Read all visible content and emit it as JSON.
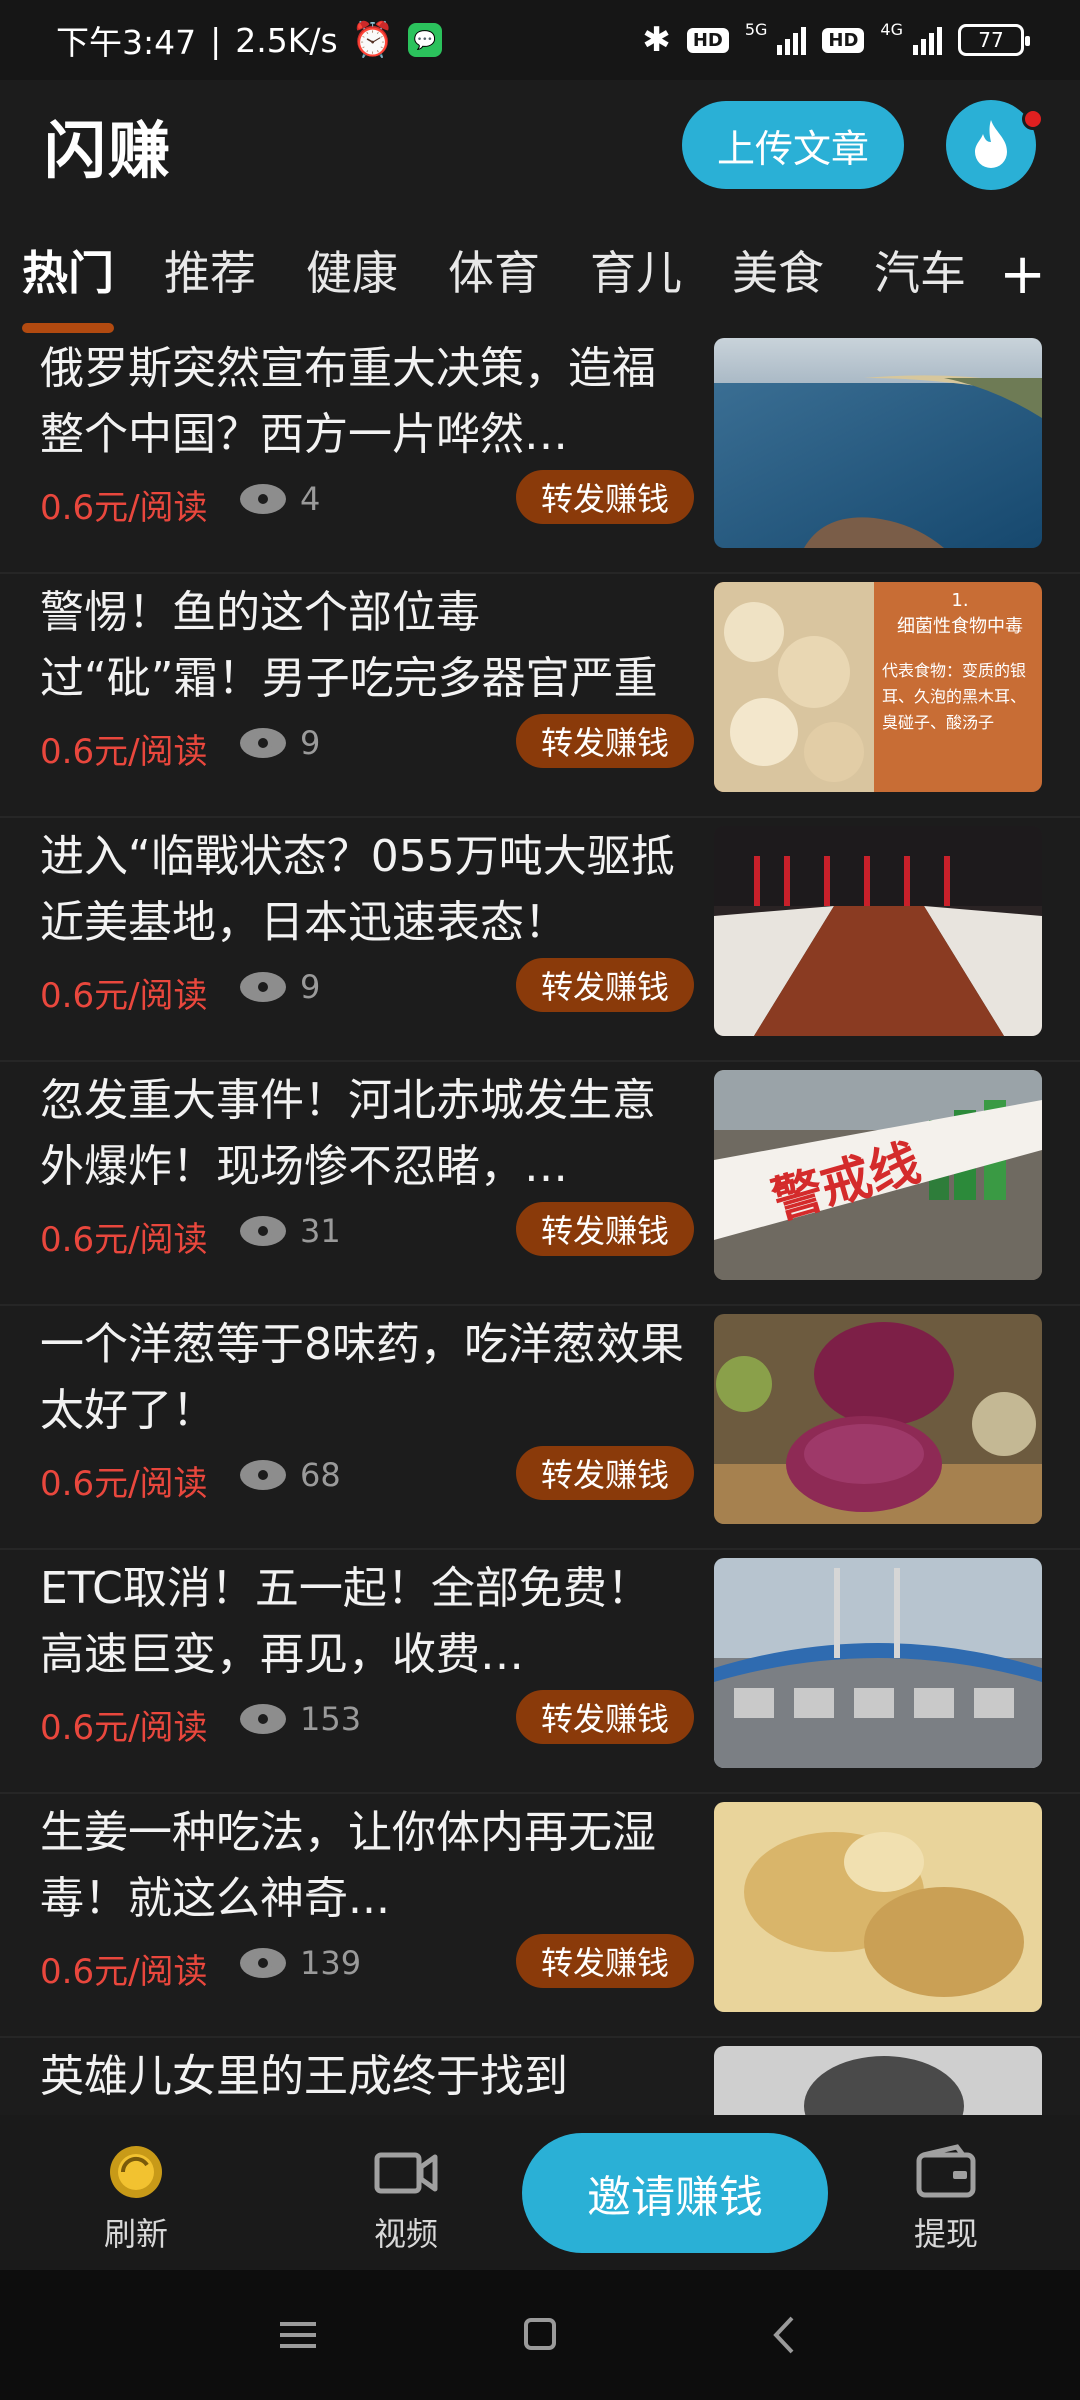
{
  "status_bar": {
    "time": "下午3:47",
    "speed": "2.5K/s",
    "network_1": "5G",
    "network_2": "4G",
    "hd": "HD",
    "battery": "77"
  },
  "header": {
    "title": "闪赚",
    "upload_label": "上传文章"
  },
  "tabs": [
    {
      "label": "热门"
    },
    {
      "label": "推荐"
    },
    {
      "label": "健康"
    },
    {
      "label": "体育"
    },
    {
      "label": "育儿"
    },
    {
      "label": "美食"
    },
    {
      "label": "汽车"
    }
  ],
  "tab_add": "+",
  "articles": [
    {
      "title": "俄罗斯突然宣布重大决策，造福整个中国？西方一片哗然…",
      "price": "0.6元/阅读",
      "views": "4",
      "share": "转发赚钱"
    },
    {
      "title": "警惕！鱼的这个部位毒过“砒”霜！男子吃完多器官严重受损",
      "price": "0.6元/阅读",
      "views": "9",
      "share": "转发赚钱"
    },
    {
      "title": "进入“临戰状态？055万吨大驱抵近美基地，日本迅速表态！",
      "price": "0.6元/阅读",
      "views": "9",
      "share": "转发赚钱"
    },
    {
      "title": "忽发重大事件！河北赤城发生意外爆炸！现场惨不忍睹，…",
      "price": "0.6元/阅读",
      "views": "31",
      "share": "转发赚钱"
    },
    {
      "title": "一个洋葱等于8味药，吃洋葱效果太好了！",
      "price": "0.6元/阅读",
      "views": "68",
      "share": "转发赚钱"
    },
    {
      "title": "ETC取消！五一起！全部免费！高速巨变，再见，收费…",
      "price": "0.6元/阅读",
      "views": "153",
      "share": "转发赚钱"
    },
    {
      "title": "生姜一种吃法，让你体内再无湿毒！就这么神奇...",
      "price": "0.6元/阅读",
      "views": "139",
      "share": "转发赚钱"
    },
    {
      "title": "英雄儿女里的王成终于找到",
      "price": "",
      "views": "",
      "share": ""
    }
  ],
  "thumb_texts": {
    "food_poison_num": "1.",
    "food_poison_title": "细菌性食物中毒",
    "food_poison_body": "代表食物：变质的银耳、久泡的黑木耳、臭碰子、酸汤子",
    "cordon": "警戒线"
  },
  "bottom_nav": {
    "refresh": "刷新",
    "video": "视频",
    "invite": "邀请赚钱",
    "withdraw": "提现"
  },
  "colors": {
    "accent": "#2ab0d6",
    "price_red": "#e9473d",
    "share_brown": "#8a3a0a",
    "tab_underline": "#b24a10"
  }
}
